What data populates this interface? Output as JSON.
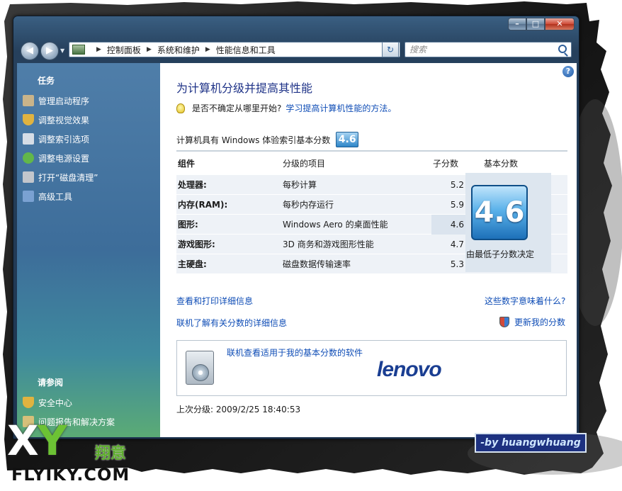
{
  "addressbar": {
    "crumbs": [
      "控制面板",
      "系统和维护",
      "性能信息和工具"
    ]
  },
  "search": {
    "placeholder": "搜索"
  },
  "caption": {
    "minimize": "–",
    "maximize": "□",
    "close": "✕"
  },
  "taskpane": {
    "tasks_heading": "任务",
    "tasks": [
      {
        "label": "管理启动程序",
        "icon": "startup-programs-icon",
        "color": "#c9b48a"
      },
      {
        "label": "调整视觉效果",
        "icon": "shield-icon",
        "color": "#e0b340"
      },
      {
        "label": "调整索引选项",
        "icon": "indexing-icon",
        "color": "#d6dde6"
      },
      {
        "label": "调整电源设置",
        "icon": "power-icon",
        "color": "#62b74a"
      },
      {
        "label": "打开“磁盘清理”",
        "icon": "disk-cleanup-icon",
        "color": "#c2c6cc"
      },
      {
        "label": "高级工具",
        "icon": "tools-icon",
        "color": "#7aa1d2"
      }
    ],
    "see_also_heading": "请参阅",
    "see_also": [
      {
        "label": "安全中心",
        "icon": "security-center-icon",
        "color": "#e0b340"
      },
      {
        "label": "问题报告和解决方案",
        "icon": "problem-reports-icon",
        "color": "#d6c07a"
      }
    ]
  },
  "content": {
    "title": "为计算机分级并提高其性能",
    "hint_text": "是否不确定从哪里开始?",
    "hint_link": "学习提高计算机性能的方法。",
    "score_label": "计算机具有 Windows 体验索引基本分数",
    "base_score": "4.6",
    "table": {
      "headers": [
        "组件",
        "分级的项目",
        "子分数",
        "基本分数"
      ],
      "rows": [
        {
          "component": "处理器:",
          "item": "每秒计算",
          "subscore": "5.2"
        },
        {
          "component": "内存(RAM):",
          "item": "每秒内存运行",
          "subscore": "5.9"
        },
        {
          "component": "图形:",
          "item": "Windows Aero 的桌面性能",
          "subscore": "4.6"
        },
        {
          "component": "游戏图形:",
          "item": "3D 商务和游戏图形性能",
          "subscore": "4.7"
        },
        {
          "component": "主硬盘:",
          "item": "磁盘数据传输速率",
          "subscore": "5.3"
        }
      ],
      "base_caption": "由最低子分数决定"
    },
    "links": {
      "print_details": "查看和打印详细信息",
      "what_numbers_mean": "这些数字意味着什么?",
      "learn_online": "联机了解有关分数的详细信息",
      "update_score": "更新我的分数"
    },
    "promo": {
      "link": "联机查看适用于我的基本分数的软件",
      "logo_text": "lenovo"
    },
    "last_rating": "上次分级: 2009/2/25 18:40:53"
  },
  "watermark": {
    "x": "X",
    "y": "Y",
    "chinese": "翔意",
    "site": "FLYIKY.COM",
    "author": "-by huangwhuang"
  },
  "colors": {
    "title_blue": "#1e3287",
    "link_blue": "#0f4db6",
    "pane_top": "#4f7ea9",
    "pane_bottom": "#5bab75",
    "badge_blue": "#2f86c8"
  }
}
